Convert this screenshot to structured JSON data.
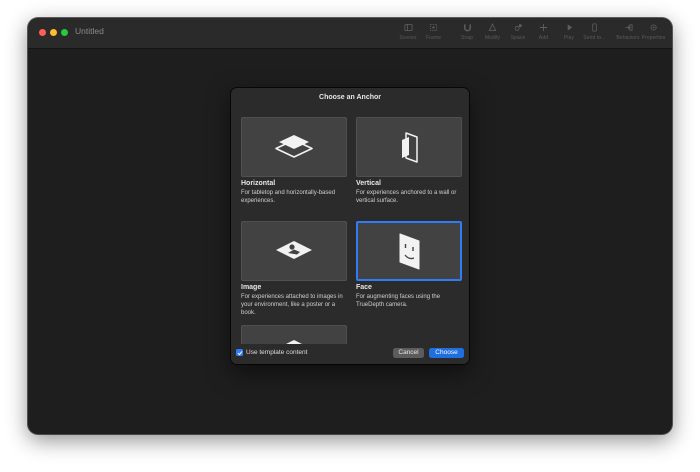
{
  "window": {
    "title": "Untitled"
  },
  "toolbar": {
    "items": [
      {
        "label": "Scenes",
        "icon": "sidebar-icon"
      },
      {
        "label": "Frame",
        "icon": "frame-icon"
      },
      {
        "label": "Snap",
        "icon": "magnet-icon"
      },
      {
        "label": "Modify",
        "icon": "modify-icon"
      },
      {
        "label": "Space",
        "icon": "space-icon"
      },
      {
        "label": "Add",
        "icon": "plus-icon"
      },
      {
        "label": "Play",
        "icon": "play-icon"
      },
      {
        "label": "Send to...",
        "icon": "phone-icon"
      },
      {
        "label": "Behaviors",
        "icon": "behaviors-icon"
      },
      {
        "label": "Properties",
        "icon": "gear-icon"
      }
    ]
  },
  "sheet": {
    "title": "Choose an Anchor",
    "anchors": [
      {
        "name": "Horizontal",
        "description": "For tabletop and horizontally-based experiences.",
        "icon": "horizontal-plane-icon",
        "selected": false
      },
      {
        "name": "Vertical",
        "description": "For experiences anchored to a wall or vertical surface.",
        "icon": "vertical-plane-icon",
        "selected": false
      },
      {
        "name": "Image",
        "description": "For experiences attached to images in your environment, like a poster or a book.",
        "icon": "image-anchor-icon",
        "selected": false
      },
      {
        "name": "Face",
        "description": "For augmenting faces using the TrueDepth camera.",
        "icon": "face-anchor-icon",
        "selected": true
      },
      {
        "name": "",
        "description": "",
        "icon": "object-anchor-icon",
        "selected": false
      }
    ],
    "footer": {
      "use_template_label": "Use template content",
      "use_template_checked": true,
      "cancel_label": "Cancel",
      "choose_label": "Choose"
    }
  },
  "colors": {
    "accent": "#2f7cf6",
    "window_bg": "#1f1e1e",
    "sheet_bg": "#2c2b2b",
    "card_bg": "#434242"
  }
}
